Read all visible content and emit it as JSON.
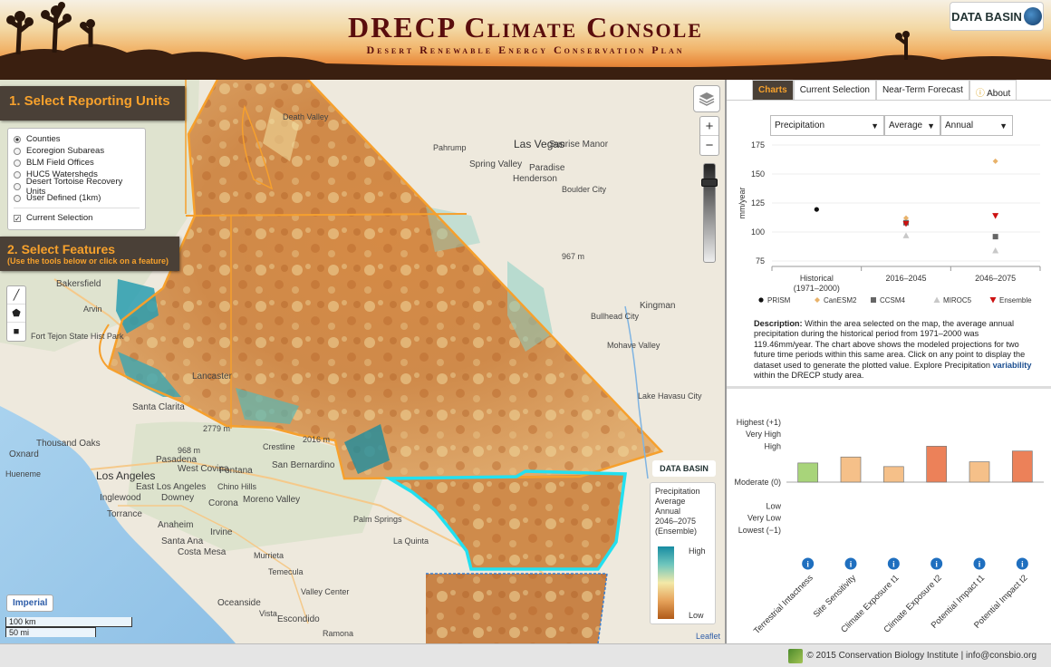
{
  "header": {
    "title": "DRECP Climate Console",
    "subtitle": "Desert Renewable Energy Conservation Plan",
    "logo_text": "DATA BASIN"
  },
  "map": {
    "select_units_title": "1. Select Reporting Units",
    "units": [
      {
        "label": "Counties",
        "selected": true
      },
      {
        "label": "Ecoregion Subareas",
        "selected": false
      },
      {
        "label": "BLM Field Offices",
        "selected": false
      },
      {
        "label": "HUC5 Watersheds",
        "selected": false
      },
      {
        "label": "Desert Tortoise Recovery Units",
        "selected": false
      },
      {
        "label": "User Defined (1km)",
        "selected": false
      }
    ],
    "current_selection_label": "Current Selection",
    "select_features_title": "2. Select Features",
    "select_features_hint": "(Use the tools below or click on a feature)",
    "imperial_label": "Imperial",
    "scale_km": "100 km",
    "scale_mi": "50 mi",
    "leaflet_label": "Leaflet",
    "legend": {
      "logo": "DATA BASIN",
      "line1": "Precipitation",
      "line2": "Average",
      "line3": "Annual",
      "line4": "2046–2075",
      "line5": "(Ensemble)",
      "high": "High",
      "low": "Low"
    },
    "place_labels": {
      "death_valley": "Death Valley",
      "pahrump": "Pahrump",
      "las_vegas": "Las Vegas",
      "sunrise_manor": "Sunrise Manor",
      "spring_valley": "Spring Valley",
      "paradise": "Paradise",
      "henderson": "Henderson",
      "boulder_city": "Boulder City",
      "bakersfield": "Bakersfield",
      "arvin": "Arvin",
      "fort_tejon": "Fort Tejon State Hist Park",
      "lancaster": "Lancaster",
      "santa_clarita": "Santa Clarita",
      "thousand_oaks": "Thousand Oaks",
      "oxnard": "Oxnard",
      "hueneme": "Hueneme",
      "pasadena": "Pasadena",
      "los_angeles": "Los Angeles",
      "west_covina": "West Covina",
      "fontana": "Fontana",
      "san_bernardino": "San Bernardino",
      "crestline": "Crestline",
      "inglewood": "Inglewood",
      "downey": "Downey",
      "east_los_angeles": "East Los Angeles",
      "chino_hills": "Chino Hills",
      "moreno_valley": "Moreno Valley",
      "torrance": "Torrance",
      "anaheim": "Anaheim",
      "corona": "Corona",
      "santa_ana": "Santa Ana",
      "irvine": "Irvine",
      "costa_mesa": "Costa Mesa",
      "murrieta": "Murrieta",
      "temecula": "Temecula",
      "oceanside": "Oceanside",
      "escondido": "Escondido",
      "vista": "Vista",
      "valley_center": "Valley Center",
      "la_quinta": "La Quinta",
      "palm_springs": "Palm Springs",
      "bullhead_city": "Bullhead City",
      "kingman": "Kingman",
      "mohave_valley": "Mohave Valley",
      "lake_havasu": "Lake Havasu City",
      "ramona": "Ramona",
      "elev_967": "967 m",
      "elev_2016": "2016 m",
      "elev_2779": "2779 m",
      "elev_968": "968 m"
    }
  },
  "side": {
    "tabs": [
      {
        "label": "Charts",
        "active": true
      },
      {
        "label": "Current Selection",
        "active": false
      },
      {
        "label": "Near-Term Forecast",
        "active": false
      },
      {
        "label": "About",
        "active": false
      }
    ],
    "selects": {
      "variable": "Precipitation",
      "statistic": "Average",
      "season": "Annual"
    },
    "description": {
      "lead": "Description:",
      "body": "Within the area selected on the map, the average annual precipitation during the historical period from 1971–2000 was 119.46mm/year. The chart above shows the modeled projections for two future time periods within this same area. Click on any point to display the dataset used to generate the plotted value. Explore Precipitation",
      "link": "variability",
      "tail": "within the DRECP study area."
    }
  },
  "chart_data": [
    {
      "type": "scatter",
      "ylabel": "mm/year",
      "ylim": [
        75,
        175
      ],
      "yticks": [
        75,
        100,
        125,
        150,
        175
      ],
      "categories": [
        "Historical\n(1971–2000)",
        "2016–2045",
        "2046–2075"
      ],
      "series": [
        {
          "name": "PRISM",
          "color": "#111111",
          "marker": "circle",
          "values": [
            119.46,
            null,
            null
          ]
        },
        {
          "name": "CanESM2",
          "color": "#e8b26a",
          "marker": "diamond",
          "values": [
            null,
            112,
            161
          ]
        },
        {
          "name": "CCSM4",
          "color": "#666666",
          "marker": "square",
          "values": [
            null,
            108,
            96
          ]
        },
        {
          "name": "MIROC5",
          "color": "#c8c8c8",
          "marker": "triangle",
          "values": [
            null,
            97,
            84
          ]
        },
        {
          "name": "Ensemble",
          "color": "#cc1111",
          "marker": "triangle-down",
          "values": [
            null,
            107,
            114
          ]
        }
      ]
    },
    {
      "type": "bar",
      "categories": [
        "Terrestrial Intactness",
        "Site Sensitivity",
        "Climate Exposure t1",
        "Climate Exposure t2",
        "Potential Impact t1",
        "Potential Impact t2"
      ],
      "values": [
        0.32,
        0.42,
        0.26,
        0.6,
        0.34,
        0.52
      ],
      "colors": [
        "#a8d47a",
        "#f5c089",
        "#f5c089",
        "#ec8159",
        "#f5c089",
        "#ec8159"
      ],
      "ylim": [
        -1,
        1
      ],
      "ytick_labels": [
        "Highest (+1)",
        "Very High",
        "High",
        "Moderate (0)",
        "Low",
        "Very Low",
        "Lowest (−1)"
      ],
      "ytick_values": [
        1,
        0.8,
        0.6,
        0,
        -0.4,
        -0.6,
        -0.8
      ]
    }
  ],
  "footer": {
    "text": "© 2015 Conservation Biology Institute | info@consbio.org"
  }
}
